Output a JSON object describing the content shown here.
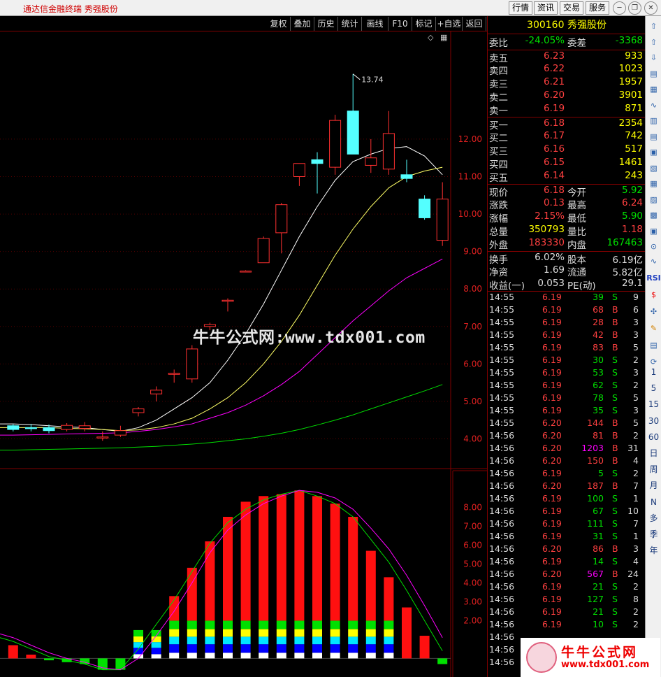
{
  "app": {
    "title": "通达信金融终端  秀强股份"
  },
  "topbar_buttons": [
    "行情",
    "资讯",
    "交易",
    "服务"
  ],
  "toolbar": [
    "复权",
    "叠加",
    "历史",
    "统计",
    "画线",
    "F10",
    "标记",
    "+自选",
    "返回"
  ],
  "stock": {
    "code": "300160",
    "name": "秀强股份"
  },
  "price_axis": [
    "12.00",
    "11.00",
    "10.00",
    "9.00",
    "8.00",
    "7.00",
    "6.00",
    "5.00",
    "4.00"
  ],
  "macd_axis": [
    "8.00",
    "7.00",
    "6.00",
    "5.00",
    "4.00",
    "3.00",
    "2.00"
  ],
  "max_label": "13.74",
  "quote": {
    "weibi": {
      "label": "委比",
      "value": "-24.05%",
      "label2": "委差",
      "value2": "-3368"
    },
    "sells": [
      {
        "label": "卖五",
        "price": "6.23",
        "vol": "933"
      },
      {
        "label": "卖四",
        "price": "6.22",
        "vol": "1023"
      },
      {
        "label": "卖三",
        "price": "6.21",
        "vol": "1957"
      },
      {
        "label": "卖二",
        "price": "6.20",
        "vol": "3901"
      },
      {
        "label": "卖一",
        "price": "6.19",
        "vol": "871"
      }
    ],
    "buys": [
      {
        "label": "买一",
        "price": "6.18",
        "vol": "2354"
      },
      {
        "label": "买二",
        "price": "6.17",
        "vol": "742"
      },
      {
        "label": "买三",
        "price": "6.16",
        "vol": "517"
      },
      {
        "label": "买四",
        "price": "6.15",
        "vol": "1461"
      },
      {
        "label": "买五",
        "price": "6.14",
        "vol": "243"
      }
    ],
    "stats": [
      {
        "l1": "现价",
        "v1": "6.18",
        "c1": "#ff4040",
        "l2": "今开",
        "v2": "5.92",
        "c2": "#00e000"
      },
      {
        "l1": "涨跌",
        "v1": "0.13",
        "c1": "#ff4040",
        "l2": "最高",
        "v2": "6.24",
        "c2": "#ff4040"
      },
      {
        "l1": "涨幅",
        "v1": "2.15%",
        "c1": "#ff4040",
        "l2": "最低",
        "v2": "5.90",
        "c2": "#00e000"
      },
      {
        "l1": "总量",
        "v1": "350793",
        "c1": "#ffff00",
        "l2": "量比",
        "v2": "1.18",
        "c2": "#ff4040"
      },
      {
        "l1": "外盘",
        "v1": "183330",
        "c1": "#ff4040",
        "l2": "内盘",
        "v2": "167463",
        "c2": "#00e000"
      }
    ],
    "fund": [
      {
        "l1": "换手",
        "v1": "6.02%",
        "l2": "股本",
        "v2": "6.19亿"
      },
      {
        "l1": "净资",
        "v1": "1.69",
        "l2": "流通",
        "v2": "5.82亿"
      },
      {
        "l1": "收益(一)",
        "v1": "0.053",
        "l2": "PE(动)",
        "v2": "29.1"
      }
    ]
  },
  "ticks": [
    {
      "t": "14:55",
      "p": "6.19",
      "v": "39",
      "d": "S",
      "n": "9"
    },
    {
      "t": "14:55",
      "p": "6.19",
      "v": "68",
      "d": "B",
      "n": "6"
    },
    {
      "t": "14:55",
      "p": "6.19",
      "v": "28",
      "d": "B",
      "n": "3"
    },
    {
      "t": "14:55",
      "p": "6.19",
      "v": "42",
      "d": "B",
      "n": "3"
    },
    {
      "t": "14:55",
      "p": "6.19",
      "v": "83",
      "d": "B",
      "n": "5"
    },
    {
      "t": "14:55",
      "p": "6.19",
      "v": "30",
      "d": "S",
      "n": "2"
    },
    {
      "t": "14:55",
      "p": "6.19",
      "v": "53",
      "d": "S",
      "n": "3"
    },
    {
      "t": "14:55",
      "p": "6.19",
      "v": "62",
      "d": "S",
      "n": "2"
    },
    {
      "t": "14:55",
      "p": "6.19",
      "v": "78",
      "d": "S",
      "n": "5"
    },
    {
      "t": "14:55",
      "p": "6.19",
      "v": "35",
      "d": "S",
      "n": "3"
    },
    {
      "t": "14:55",
      "p": "6.20",
      "v": "144",
      "d": "B",
      "n": "5"
    },
    {
      "t": "14:56",
      "p": "6.20",
      "v": "81",
      "d": "B",
      "n": "2"
    },
    {
      "t": "14:56",
      "p": "6.20",
      "v": "1203",
      "d": "B",
      "n": "31"
    },
    {
      "t": "14:56",
      "p": "6.20",
      "v": "150",
      "d": "B",
      "n": "4"
    },
    {
      "t": "14:56",
      "p": "6.19",
      "v": "5",
      "d": "S",
      "n": "2"
    },
    {
      "t": "14:56",
      "p": "6.20",
      "v": "187",
      "d": "B",
      "n": "7"
    },
    {
      "t": "14:56",
      "p": "6.19",
      "v": "100",
      "d": "S",
      "n": "1"
    },
    {
      "t": "14:56",
      "p": "6.19",
      "v": "67",
      "d": "S",
      "n": "10"
    },
    {
      "t": "14:56",
      "p": "6.19",
      "v": "111",
      "d": "S",
      "n": "7"
    },
    {
      "t": "14:56",
      "p": "6.19",
      "v": "31",
      "d": "S",
      "n": "1"
    },
    {
      "t": "14:56",
      "p": "6.20",
      "v": "86",
      "d": "B",
      "n": "3"
    },
    {
      "t": "14:56",
      "p": "6.19",
      "v": "14",
      "d": "S",
      "n": "4"
    },
    {
      "t": "14:56",
      "p": "6.20",
      "v": "567",
      "d": "B",
      "n": "24"
    },
    {
      "t": "14:56",
      "p": "6.19",
      "v": "21",
      "d": "S",
      "n": "2"
    },
    {
      "t": "14:56",
      "p": "6.19",
      "v": "127",
      "d": "S",
      "n": "8"
    },
    {
      "t": "14:56",
      "p": "6.19",
      "v": "21",
      "d": "S",
      "n": "2"
    },
    {
      "t": "14:56",
      "p": "6.19",
      "v": "10",
      "d": "S",
      "n": "2"
    },
    {
      "t": "14:56",
      "p": "",
      "v": "",
      "d": "",
      "n": ""
    },
    {
      "t": "14:56",
      "p": "",
      "v": "",
      "d": "",
      "n": ""
    },
    {
      "t": "14:56",
      "p": "",
      "v": "",
      "d": "",
      "n": ""
    }
  ],
  "sidebar_labels": [
    "RSI",
    "1",
    "5",
    "15",
    "30",
    "60",
    "日",
    "周",
    "月",
    "N",
    "多",
    "季",
    "年"
  ],
  "watermark": "牛牛公式网:www.tdx001.com",
  "logo": {
    "cn": "牛牛公式网",
    "url": "www.tdx001.com"
  },
  "chart_data": {
    "type": "candlestick",
    "candles": [
      {
        "o": 4.35,
        "c": 4.25,
        "h": 4.4,
        "l": 4.2
      },
      {
        "o": 4.3,
        "c": 4.28,
        "h": 4.4,
        "l": 4.2
      },
      {
        "o": 4.3,
        "c": 4.22,
        "h": 4.38,
        "l": 4.15
      },
      {
        "o": 4.25,
        "c": 4.36,
        "h": 4.42,
        "l": 4.2
      },
      {
        "o": 4.28,
        "c": 4.35,
        "h": 4.45,
        "l": 4.2
      },
      {
        "o": 4.05,
        "c": 4.05,
        "h": 4.2,
        "l": 3.95
      },
      {
        "o": 4.1,
        "c": 4.22,
        "h": 4.35,
        "l": 4.05
      },
      {
        "o": 4.7,
        "c": 4.8,
        "h": 4.85,
        "l": 4.6
      },
      {
        "o": 5.2,
        "c": 5.3,
        "h": 5.4,
        "l": 5.0
      },
      {
        "o": 5.75,
        "c": 5.75,
        "h": 5.85,
        "l": 5.5
      },
      {
        "o": 5.6,
        "c": 6.4,
        "h": 6.5,
        "l": 5.5
      },
      {
        "o": 7.0,
        "c": 7.05,
        "h": 7.1,
        "l": 6.9
      },
      {
        "o": 7.7,
        "c": 7.7,
        "h": 7.75,
        "l": 7.4
      },
      {
        "o": 8.48,
        "c": 8.48,
        "h": 8.5,
        "l": 8.46
      },
      {
        "o": 8.7,
        "c": 9.35,
        "h": 9.4,
        "l": 8.7
      },
      {
        "o": 9.5,
        "c": 10.25,
        "h": 10.3,
        "l": 8.95
      },
      {
        "o": 11.0,
        "c": 11.35,
        "h": 11.35,
        "l": 10.75
      },
      {
        "o": 11.45,
        "c": 11.35,
        "h": 11.65,
        "l": 10.55
      },
      {
        "o": 11.25,
        "c": 12.5,
        "h": 12.65,
        "l": 11.05
      },
      {
        "o": 12.75,
        "c": 11.6,
        "h": 13.74,
        "l": 11.6
      },
      {
        "o": 11.3,
        "c": 11.5,
        "h": 12.0,
        "l": 11.1
      },
      {
        "o": 11.2,
        "c": 12.15,
        "h": 12.75,
        "l": 11.05
      },
      {
        "o": 11.05,
        "c": 10.95,
        "h": 11.45,
        "l": 10.85
      },
      {
        "o": 10.4,
        "c": 9.9,
        "h": 10.5,
        "l": 9.85
      },
      {
        "o": 9.3,
        "c": 10.4,
        "h": 10.85,
        "l": 9.15
      }
    ],
    "ma_white": [
      4.4,
      4.38,
      4.35,
      4.32,
      4.3,
      4.25,
      4.2,
      4.3,
      4.5,
      4.8,
      5.1,
      5.5,
      6.1,
      6.8,
      7.6,
      8.5,
      9.4,
      10.2,
      10.9,
      11.4,
      11.6,
      11.75,
      11.8,
      11.55,
      11.05
    ],
    "ma_yellow": [
      4.3,
      4.3,
      4.3,
      4.28,
      4.27,
      4.25,
      4.22,
      4.24,
      4.3,
      4.4,
      4.55,
      4.8,
      5.1,
      5.5,
      6.0,
      6.6,
      7.3,
      8.1,
      8.9,
      9.6,
      10.2,
      10.7,
      11.0,
      11.15,
      11.25
    ],
    "ma_magenta": [
      4.1,
      4.11,
      4.12,
      4.13,
      4.14,
      4.15,
      4.16,
      4.2,
      4.25,
      4.32,
      4.4,
      4.55,
      4.7,
      4.9,
      5.15,
      5.45,
      5.8,
      6.25,
      6.7,
      7.15,
      7.55,
      7.95,
      8.3,
      8.55,
      8.8
    ],
    "ma_green": [
      3.7,
      3.71,
      3.72,
      3.73,
      3.74,
      3.75,
      3.76,
      3.78,
      3.8,
      3.83,
      3.86,
      3.9,
      3.95,
      4.0,
      4.07,
      4.15,
      4.25,
      4.37,
      4.5,
      4.64,
      4.8,
      4.96,
      5.12,
      5.28,
      5.45
    ],
    "price_range": [
      3.3,
      14.5
    ],
    "hist": [
      0.7,
      0.2,
      -0.1,
      -0.2,
      -0.3,
      -0.6,
      -0.6,
      1.5,
      1.5,
      3.3,
      4.8,
      6.2,
      7.5,
      8.3,
      8.6,
      8.7,
      8.9,
      8.6,
      8.2,
      7.5,
      5.7,
      4.3,
      2.7,
      1.2,
      -0.3
    ],
    "hist_green": [
      false,
      false,
      true,
      true,
      true,
      true,
      true,
      false,
      false,
      false,
      false,
      false,
      false,
      false,
      false,
      false,
      false,
      false,
      false,
      false,
      false,
      false,
      false,
      false,
      true
    ],
    "band_top": [
      0,
      0,
      0,
      0,
      0,
      0,
      0,
      1.5,
      1.5,
      2.0,
      2.0,
      2.0,
      2.0,
      2.0,
      2.0,
      2.0,
      2.0,
      2.0,
      2.0,
      2.0,
      2.0,
      2.0,
      0,
      0,
      0
    ],
    "dif": [
      0.9,
      0.5,
      0.1,
      -0.1,
      -0.3,
      -0.6,
      -0.6,
      0.5,
      1.8,
      3.1,
      4.6,
      6.1,
      7.2,
      7.9,
      8.4,
      8.7,
      8.9,
      8.6,
      8.2,
      7.5,
      6.3,
      5.1,
      3.6,
      2.0,
      0.4
    ],
    "dea": [
      1.1,
      0.7,
      0.3,
      0.0,
      -0.2,
      -0.5,
      -0.6,
      0.0,
      1.2,
      2.5,
      4.0,
      5.6,
      6.8,
      7.6,
      8.2,
      8.6,
      8.9,
      8.8,
      8.5,
      7.9,
      6.9,
      5.8,
      4.4,
      2.8,
      1.1
    ],
    "macd_range": [
      -0.8,
      9.5
    ]
  }
}
